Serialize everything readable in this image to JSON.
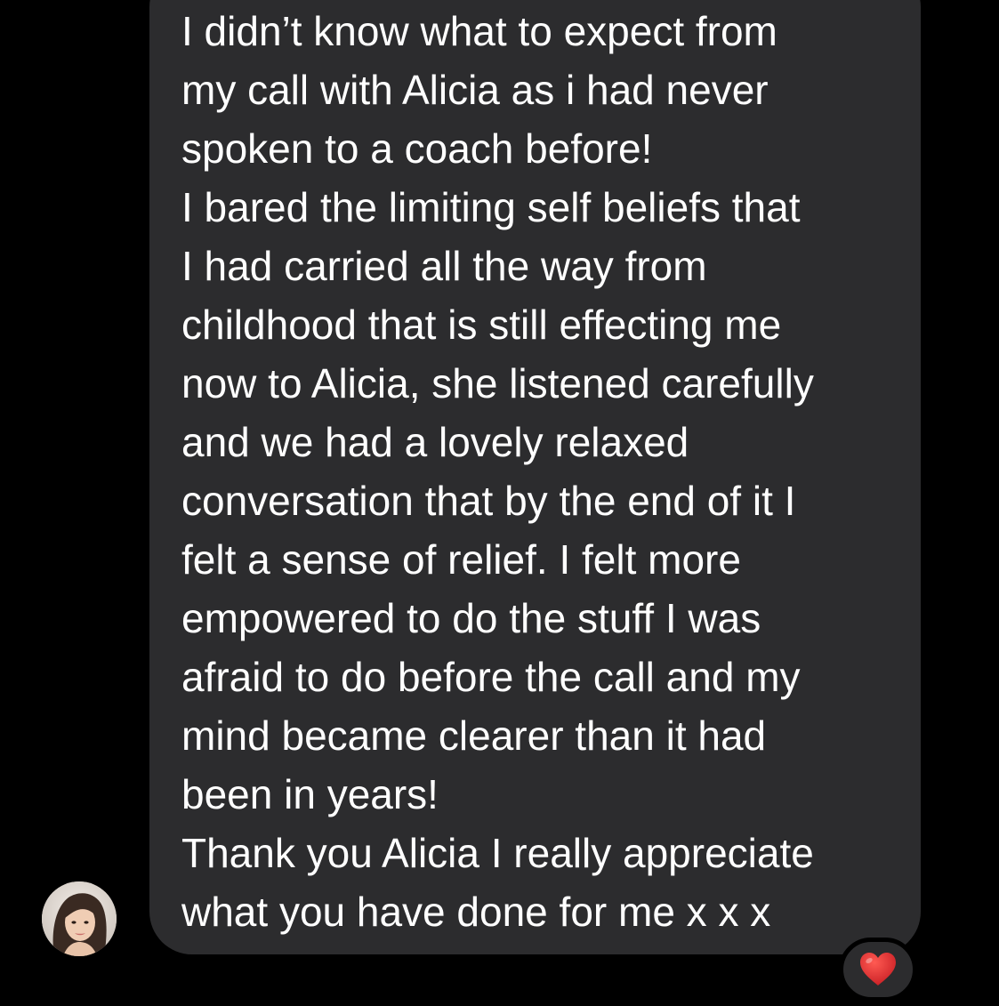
{
  "message": {
    "lines": [
      "I didn’t know what to expect from",
      "my call with Alicia as i had never",
      "spoken to a coach before!",
      "I bared the limiting self beliefs that",
      "I had carried all the way from",
      "childhood that is still effecting me",
      "now to Alicia, she listened carefully",
      "and we had a lovely relaxed",
      "conversation that by the end of it I",
      "felt a sense of relief. I felt more",
      "empowered to do the stuff I was",
      "afraid to do before the call and my",
      "mind became clearer than it had",
      "been in years!",
      "Thank you Alicia I really appreciate",
      "what you have done for me x x x"
    ]
  },
  "sender": {
    "avatar_icon": "profile-photo"
  },
  "reaction": {
    "icon": "red-heart-icon",
    "color": "#e0262a"
  },
  "colors": {
    "background": "#000000",
    "bubble": "#2c2c2e",
    "text": "#ffffff"
  }
}
